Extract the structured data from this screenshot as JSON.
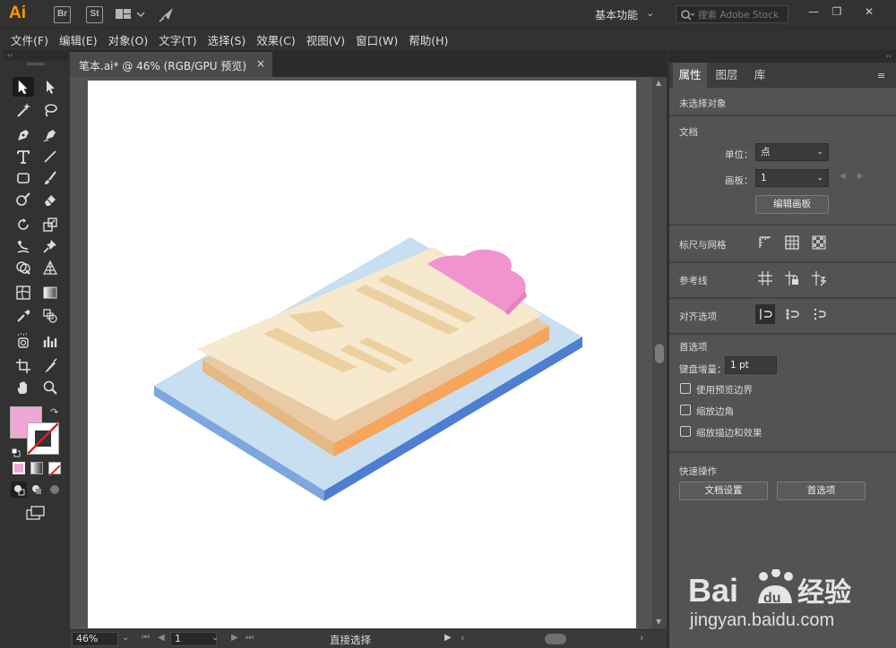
{
  "app": {
    "logo": "Ai",
    "bridge_label": "Br",
    "stock_label": "St",
    "workspace": "基本功能",
    "search_placeholder": "搜索 Adobe Stock",
    "window_buttons": [
      "minimize",
      "maximize",
      "close"
    ]
  },
  "menubar": {
    "items": [
      "文件(F)",
      "编辑(E)",
      "对象(O)",
      "文字(T)",
      "选择(S)",
      "效果(C)",
      "视图(V)",
      "窗口(W)",
      "帮助(H)"
    ]
  },
  "document": {
    "tab_title": "笔本.ai* @ 46% (RGB/GPU 预览)",
    "close_glyph": "×"
  },
  "statusbar": {
    "zoom": "46%",
    "artboard": "1",
    "status": "直接选择"
  },
  "colors": {
    "fill": "#f1a7d6",
    "stroke": "none",
    "clipboard_board_top": "#c5dff0",
    "clipboard_board_side": "#5f8fd6",
    "paper": "#f7e7c7",
    "paper_stack": "#e8c9a5",
    "paper_stack_side": "#f6a55a",
    "clip": "#f193ce"
  },
  "tools": [
    "selection-tool",
    "direct-selection-tool",
    "magic-wand-tool",
    "lasso-tool",
    "pen-tool",
    "curvature-tool",
    "type-tool",
    "line-tool",
    "rectangle-tool",
    "paintbrush-tool",
    "shaper-tool",
    "eraser-tool",
    "rotate-tool",
    "scale-tool",
    "puppet-warp-tool",
    "pin-tool",
    "shape-builder-tool",
    "perspective-grid-tool",
    "mesh-tool",
    "gradient-tool",
    "eyedropper-tool",
    "blend-tool",
    "symbol-sprayer-tool",
    "column-graph-tool",
    "artboard-tool",
    "slice-tool",
    "hand-tool",
    "zoom-tool"
  ],
  "rightpanel": {
    "tabs": [
      "属性",
      "图层",
      "库"
    ],
    "no_selection": "未选择对象",
    "document_section": "文档",
    "units_label": "单位：",
    "units_value": "点",
    "artboard_label": "画板：",
    "artboard_value": "1",
    "edit_artboards": "编辑画板",
    "rulers_grids": "标尺与网格",
    "guides": "参考线",
    "snap_options": "对齐选项",
    "preferences": "首选项",
    "keyboard_increment_label": "键盘增量：",
    "keyboard_increment_value": "1 pt",
    "use_preview_bounds": "使用预览边界",
    "scale_corners": "缩放边角",
    "scale_strokes_effects": "缩放描边和效果",
    "quick_actions": "快速操作",
    "document_setup": "文档设置",
    "preferences_button": "首选项"
  },
  "watermark": {
    "logo_text": "Bai du 经验",
    "url": "jingyan.baidu.com"
  }
}
